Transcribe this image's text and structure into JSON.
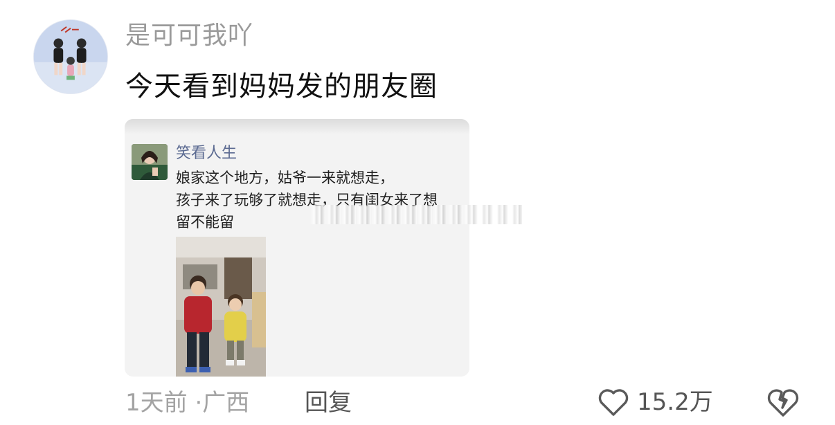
{
  "comment": {
    "username": "是可可我吖",
    "text": "今天看到妈妈发的朋友圈",
    "time": "1天前",
    "separator": "·",
    "location": "广西",
    "reply_label": "回复",
    "likes": "15.2万"
  },
  "embedded_post": {
    "author": "笑看人生",
    "lines": [
      "娘家这个地方，姑爷一来就想走，",
      "孩子来了玩够了就想走，只有闺女来了想",
      "留不能留"
    ]
  },
  "icons": {
    "like": "heart-outline-icon",
    "dislike": "broken-heart-icon"
  },
  "colors": {
    "username": "#9a9a9a",
    "meta": "#a3a3a3",
    "post_author": "#5b6a91"
  }
}
